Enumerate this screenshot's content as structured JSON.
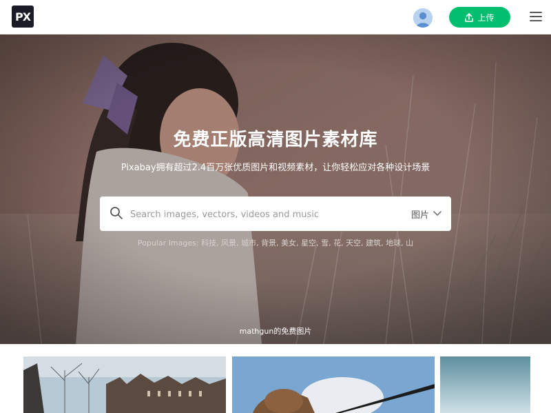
{
  "header": {
    "logo_text": "PX",
    "upload_label": "上传",
    "icons": [
      "upload-icon",
      "user-avatar-icon",
      "hamburger-menu-icon"
    ],
    "colors": {
      "upload_button": "#02be6e",
      "logo_bg": "#191b26"
    }
  },
  "hero": {
    "title": "免费正版高清图片素材库",
    "subtitle": "Pixabay拥有超过2.4百万张优质图片和视频素材，让你轻松应对各种设计场景",
    "search": {
      "placeholder": "Search images, vectors, videos and music",
      "value": "",
      "type_selected": "图片"
    },
    "popular_label": "Popular Images:",
    "popular_tags": [
      "科技",
      "风景",
      "城市",
      "背景",
      "美女",
      "星空",
      "雪",
      "花",
      "天空",
      "建筑",
      "地球",
      "山"
    ],
    "credit": "mathgun的免费图片"
  }
}
